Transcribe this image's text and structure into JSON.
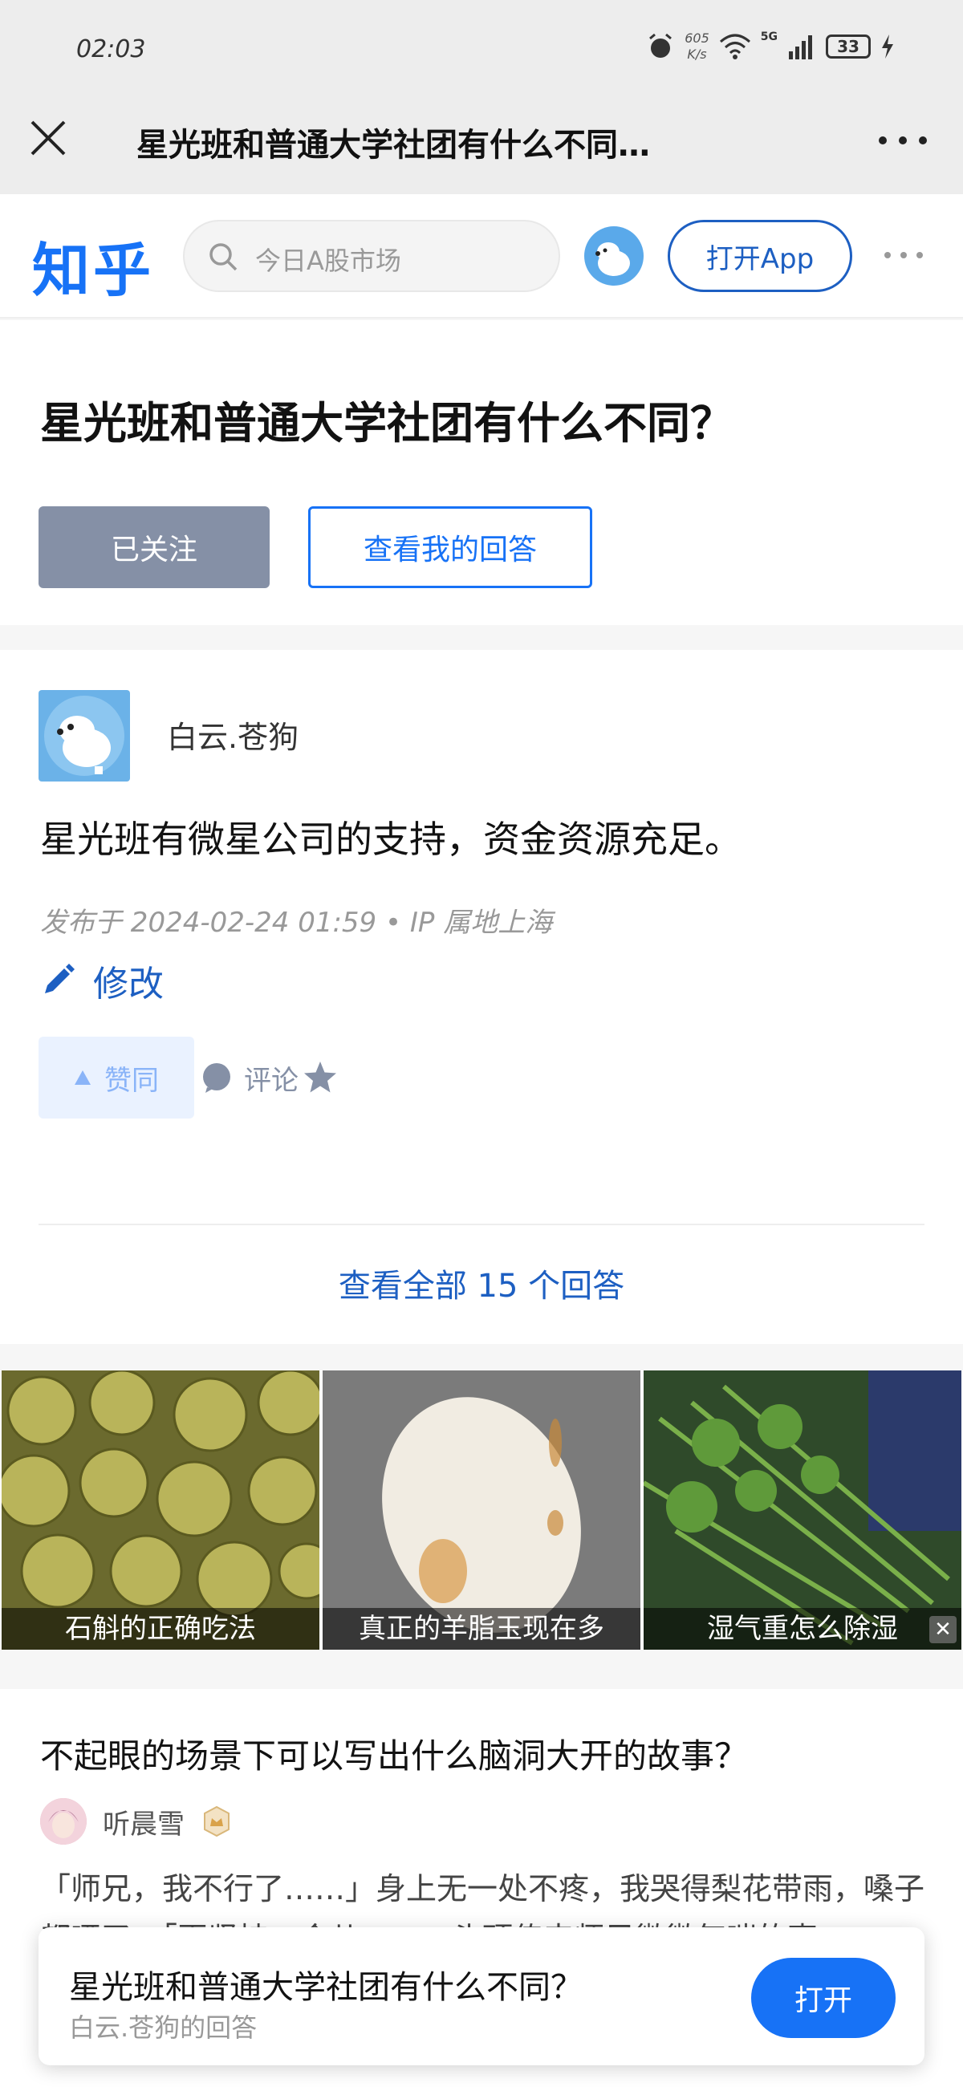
{
  "status_bar": {
    "time": "02:03",
    "network_speed_value": "605",
    "network_speed_unit": "K/s",
    "network_type": "5G",
    "battery": "33"
  },
  "top_nav": {
    "title": "星光班和普通大学社团有什么不同…"
  },
  "zhihu_header": {
    "logo": "知乎",
    "search_placeholder": "今日A股市场",
    "open_app_label": "打开App"
  },
  "question": {
    "title": "星光班和普通大学社团有什么不同？",
    "followed_label": "已关注",
    "my_answer_label": "查看我的回答"
  },
  "answer": {
    "author": "白云.苍狗",
    "content": "星光班有微星公司的支持，资金资源充足。",
    "meta": "发布于 2024-02-24 01:59 • IP 属地上海",
    "edit_label": "修改",
    "vote_label": "赞同",
    "comment_label": "评论",
    "view_all_label": "查看全部 15 个回答"
  },
  "ads": [
    {
      "caption": "石斛的正确吃法"
    },
    {
      "caption": "真正的羊脂玉现在多"
    },
    {
      "caption": "湿气重怎么除湿"
    }
  ],
  "recommendation": {
    "title": "不起眼的场景下可以写出什么脑洞大开的故事？",
    "author": "听晨雪",
    "excerpt": "「师兄，我不行了……」身上无一处不疼，我哭得梨花带雨，嗓子都哑了。「再坚持一会儿……」头顶传来师兄微微气喘的声"
  },
  "bottom_bar": {
    "title": "星光班和普通大学社团有什么不同？",
    "subtitle": "白云.苍狗的回答",
    "open_label": "打开"
  },
  "colors": {
    "brand_blue": "#1772f6",
    "followed_gray": "#8590a6"
  }
}
